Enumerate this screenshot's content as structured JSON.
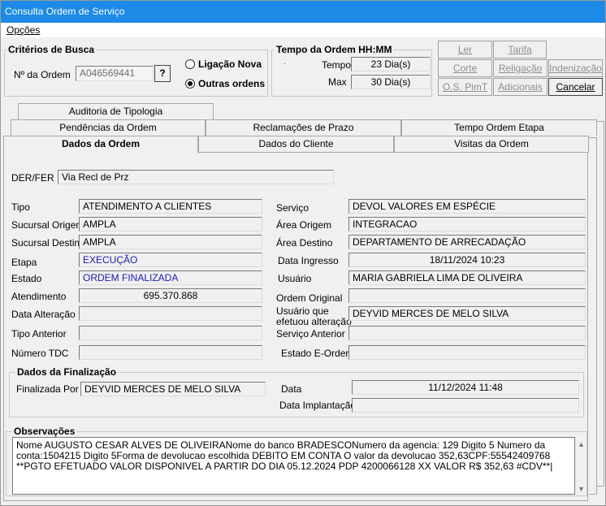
{
  "window": {
    "title": "Consulta Ordem de Serviço"
  },
  "menu": {
    "options_label": "Opções"
  },
  "criterios": {
    "title": "Critérios de Busca",
    "ordem_label": "Nº da Ordem",
    "ordem_value": "A046569441",
    "search_button": "?",
    "radio_ligacao": "Ligação Nova",
    "radio_outras": "Outras ordens",
    "selected": "Outras ordens"
  },
  "tempo": {
    "title": "Tempo da Ordem HH:MM",
    "tempo_label": "Tempo",
    "tempo_value": "23 Dia(s)",
    "max_label": "Max",
    "max_value": "30 Dia(s)"
  },
  "buttons": {
    "ler": "Ler",
    "tarifa": "Tarifa",
    "corte": "Corte",
    "religacao": "Religação",
    "indenizacao": "Indenização",
    "os_pimt": "O.S. PimT",
    "adicionais": "Adicionais",
    "cancelar": "Cancelar"
  },
  "tabs": {
    "row1": [
      "Auditoria de Tipologia"
    ],
    "row2": [
      "Pendências da Ordem",
      "Reclamações de Prazo",
      "Tempo Ordem Etapa"
    ],
    "row3": [
      "Dados da Ordem",
      "Dados do Cliente",
      "Visitas da Ordem"
    ],
    "active": "Dados da Ordem"
  },
  "dados": {
    "der_fer_label": "DER/FER",
    "der_fer_value": "Via Recl de Prz",
    "tipo_label": "Tipo",
    "tipo_value": "ATENDIMENTO A CLIENTES",
    "servico_label": "Serviço",
    "servico_value": "DEVOL VALORES EM ESPÉCIE",
    "sucursal_origem_label": "Sucursal Origem",
    "sucursal_origem_value": "AMPLA",
    "area_origem_label": "Área Origem",
    "area_origem_value": "INTEGRACAO",
    "sucursal_destino_label": "Sucursal Destino",
    "sucursal_destino_value": "AMPLA",
    "area_destino_label": "Área Destino",
    "area_destino_value": "DEPARTAMENTO DE ARRECADAÇÃO",
    "etapa_label": "Etapa",
    "etapa_value": "EXECUÇÃO",
    "data_ingresso_label": "Data Ingresso",
    "data_ingresso_value": "18/11/2024 10:23",
    "estado_label": "Estado",
    "estado_value": "ORDEM FINALIZADA",
    "usuario_label": "Usuário",
    "usuario_value": "MARIA GABRIELA LIMA DE OLIVEIRA",
    "atendimento_label": "Atendimento",
    "atendimento_value": "695.370.868",
    "ordem_original_label": "Ordem Original",
    "ordem_original_value": "",
    "data_alteracao_label": "Data Alteração",
    "data_alteracao_value": "",
    "usuario_alteracao_label_1": "Usuário que",
    "usuario_alteracao_label_2": "efetuou alteração",
    "usuario_alteracao_value": "DEYVID MERCES DE MELO SILVA",
    "tipo_anterior_label": "Tipo Anterior",
    "tipo_anterior_value": "",
    "servico_anterior_label": "Serviço Anterior",
    "servico_anterior_value": "",
    "numero_tdc_label": "Número TDC",
    "numero_tdc_value": "",
    "estado_eorder_label": "Estado E-Order",
    "estado_eorder_value": ""
  },
  "finalizacao": {
    "title": "Dados da Finalização",
    "finalizada_por_label": "Finalizada Por",
    "finalizada_por_value": "DEYVID MERCES DE MELO SILVA",
    "data_label": "Data",
    "data_value": "11/12/2024 11:48",
    "data_implantacao_label": "Data Implantação",
    "data_implantacao_value": ""
  },
  "observacoes": {
    "title": "Observações",
    "text": "Nome AUGUSTO CESAR ALVES DE OLIVEIRANome do banco BRADESCONumero da agencia: 129 Digito 5 Numero da conta:1504215 Digito 5Forma de devolucao escolhida DEBITO EM CONTA O valor da devolucao 352,63CPF:55542409768 **PGTO EFETUADO VALOR DISPONIVEL A PARTIR DO DIA 05.12.2024 PDP 4200066128 XX VALOR R$ 352,63 #CDV**|"
  }
}
